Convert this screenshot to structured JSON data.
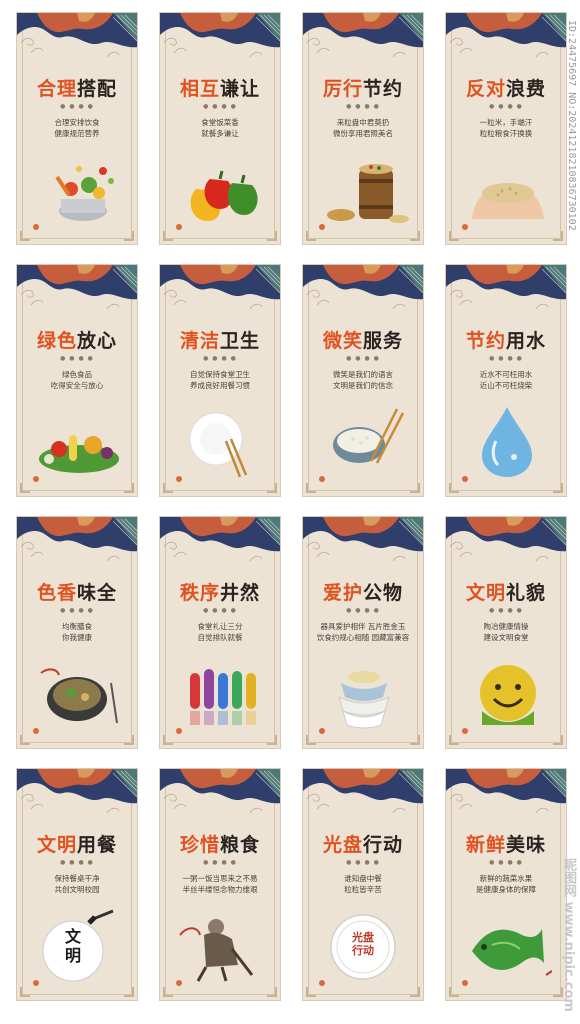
{
  "watermark": {
    "id_text": "ID:24475697 NO:20241218210836730102",
    "site_text": "昵图网 www.nipic.com"
  },
  "colors": {
    "accent": "#e0521f",
    "text": "#2a2420",
    "card": "#ede3d5",
    "navy": "#2f3e6b",
    "rust": "#c65e3e",
    "teal": "#4c7a7a"
  },
  "dots": "● ● ● ●",
  "cards": [
    {
      "title_hi": "合理",
      "title_lo": "搭配",
      "lines": [
        "合理安排饮食",
        "健康规范营养"
      ],
      "illustration": "vegetables-in-pot"
    },
    {
      "title_hi": "相互",
      "title_lo": "谦让",
      "lines": [
        "食堂饭菜香",
        "就餐多谦让"
      ],
      "illustration": "bell-peppers"
    },
    {
      "title_hi": "厉行",
      "title_lo": "节约",
      "lines": [
        "来粒盘中君莫扔",
        "微份享用君照美名"
      ],
      "illustration": "grain-barrel"
    },
    {
      "title_hi": "反对",
      "title_lo": "浪费",
      "lines": [
        "一粒米，手端汗",
        "粒粒粮食汗换换"
      ],
      "illustration": "hands-with-rice"
    },
    {
      "title_hi": "绿色",
      "title_lo": "放心",
      "lines": [
        "绿色食品",
        "吃得安全与放心"
      ],
      "illustration": "vegetable-pile"
    },
    {
      "title_hi": "清洁",
      "title_lo": "卫生",
      "lines": [
        "自觉保持食堂卫生",
        "养成良好用餐习惯"
      ],
      "illustration": "plate-chopsticks"
    },
    {
      "title_hi": "微笑",
      "title_lo": "服务",
      "lines": [
        "微笑是我们的语言",
        "文明是我们的信念"
      ],
      "illustration": "rice-bowl-chopsticks"
    },
    {
      "title_hi": "节约",
      "title_lo": "用水",
      "lines": [
        "近水不可枉用水",
        "近山不可枉烧柴"
      ],
      "illustration": "water-drop"
    },
    {
      "title_hi": "色香",
      "title_lo": "味全",
      "lines": [
        "均衡膳食",
        "你我健康"
      ],
      "illustration": "soup-bowl"
    },
    {
      "title_hi": "秩序",
      "title_lo": "井然",
      "lines": [
        "食堂礼让三分",
        "自觉排队就餐"
      ],
      "illustration": "queue-people"
    },
    {
      "title_hi": "爱护",
      "title_lo": "公物",
      "lines": [
        "器具爱护相伴  瓦片胜金玉",
        "饮食约规心相随  园藏富兼容"
      ],
      "illustration": "stacked-bowls"
    },
    {
      "title_hi": "文明",
      "title_lo": "礼貌",
      "lines": [
        "陶冶健康情操",
        "建设文明食堂"
      ],
      "illustration": "smiley-face"
    },
    {
      "title_hi": "文明",
      "title_lo": "用餐",
      "lines": [
        "保持餐桌干净",
        "共创文明校园"
      ],
      "illustration": "calligraphy-plate",
      "plate_text": "文明"
    },
    {
      "title_hi": "珍惜",
      "title_lo": "粮食",
      "lines": [
        "一粥一饭当思来之不易",
        "半丝半缕恒念物力维艰"
      ],
      "illustration": "old-farmer"
    },
    {
      "title_hi": "光盘",
      "title_lo": "行动",
      "lines": [
        "谁知盘中餐",
        "粒粒皆辛苦"
      ],
      "illustration": "clean-plate",
      "plate_text": "光盘行动"
    },
    {
      "title_hi": "新鲜",
      "title_lo": "美味",
      "lines": [
        "新鲜的蔬菜水果",
        "是健康身体的保障"
      ],
      "illustration": "leafy-fish"
    }
  ]
}
